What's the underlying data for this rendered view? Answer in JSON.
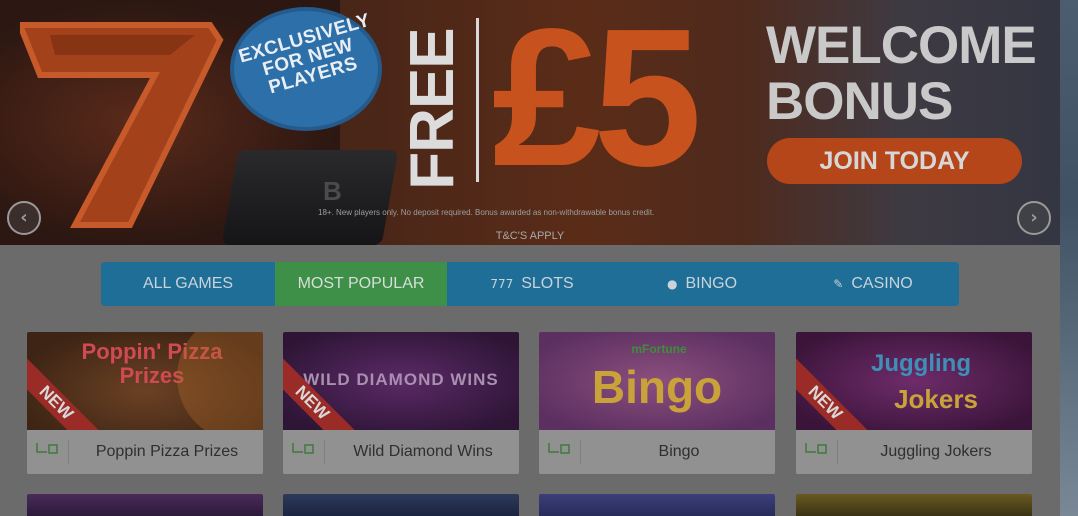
{
  "banner": {
    "badge_line1": "EXCLUSIVELY",
    "badge_line2": "FOR NEW",
    "badge_line3": "PLAYERS",
    "free_label": "FREE",
    "amount": "£5",
    "welcome_line1": "WELCOME",
    "welcome_line2": "BONUS",
    "join_button": "JOIN TODAY",
    "disclaimer": "18+. New players only. No deposit required. Bonus awarded as non-withdrawable bonus credit.",
    "tcs": "T&C'S APPLY",
    "prev_arrow": "‹",
    "next_arrow": "›",
    "slot_machine_text": "B"
  },
  "nav": {
    "items": [
      {
        "label": "ALL GAMES",
        "icon": ""
      },
      {
        "label": "MOST POPULAR",
        "icon": ""
      },
      {
        "label": "SLOTS",
        "icon": "777"
      },
      {
        "label": "BINGO",
        "icon": "●"
      },
      {
        "label": "CASINO",
        "icon": "✎"
      }
    ],
    "active_index": 1
  },
  "games": [
    {
      "name": "Poppin Pizza Prizes",
      "thumb_text": "Poppin' Pizza Prizes",
      "is_new": true,
      "ribbon": "NEW"
    },
    {
      "name": "Wild Diamond Wins",
      "thumb_text": "WILD DIAMOND WINS",
      "is_new": true,
      "ribbon": "NEW"
    },
    {
      "name": "Bingo",
      "thumb_text": "Bingo",
      "brand": "mFortune",
      "is_new": false
    },
    {
      "name": "Juggling Jokers",
      "thumb_text1": "Juggling",
      "thumb_text2": "Jokers",
      "is_new": true,
      "ribbon": "NEW"
    }
  ],
  "colors": {
    "accent_orange": "#c8521d",
    "nav_blue": "#1e6e97",
    "nav_active_green": "#3e8f47",
    "badge_blue": "#2d6fa8",
    "new_ribbon_red": "#9a2b27"
  }
}
